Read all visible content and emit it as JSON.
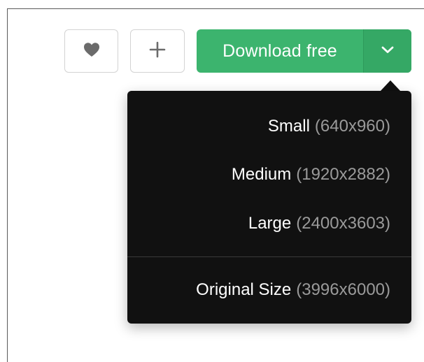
{
  "actions": {
    "like_icon": "heart-icon",
    "collect_icon": "plus-icon",
    "download_label": "Download free",
    "toggle_icon": "chevron-down-icon"
  },
  "colors": {
    "primary_green": "#3cb46e",
    "menu_bg": "#111111",
    "menu_text": "#ffffff",
    "menu_dims_text": "#9a9a9a",
    "icon_gray": "#6b6b6b"
  },
  "download_menu": {
    "items": [
      {
        "name": "Small",
        "dims": "(640x960)"
      },
      {
        "name": "Medium",
        "dims": "(1920x2882)"
      },
      {
        "name": "Large",
        "dims": "(2400x3603)"
      },
      {
        "name": "Original Size",
        "dims": "(3996x6000)"
      }
    ]
  }
}
